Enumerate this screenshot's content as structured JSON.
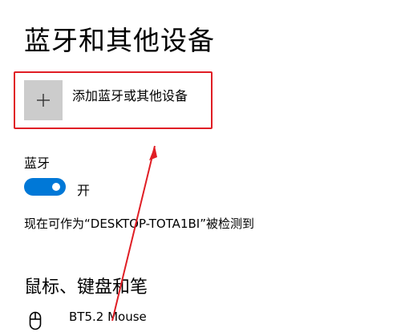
{
  "page": {
    "title": "蓝牙和其他设备"
  },
  "add_device": {
    "label": "添加蓝牙或其他设备",
    "icon": "plus-icon",
    "tile_color": "#cccccc"
  },
  "bluetooth": {
    "label": "蓝牙",
    "toggle_on": true,
    "toggle_state_text": "开",
    "accent_color": "#0078d7",
    "discoverable_text": "现在可作为“DESKTOP-TOTA1BI”被检测到"
  },
  "mouse_section": {
    "heading": "鼠标、键盘和笔",
    "devices": [
      {
        "name": "BT5.2 Mouse",
        "icon": "mouse-icon"
      }
    ]
  },
  "annotation": {
    "highlight_color": "#e01e25"
  }
}
